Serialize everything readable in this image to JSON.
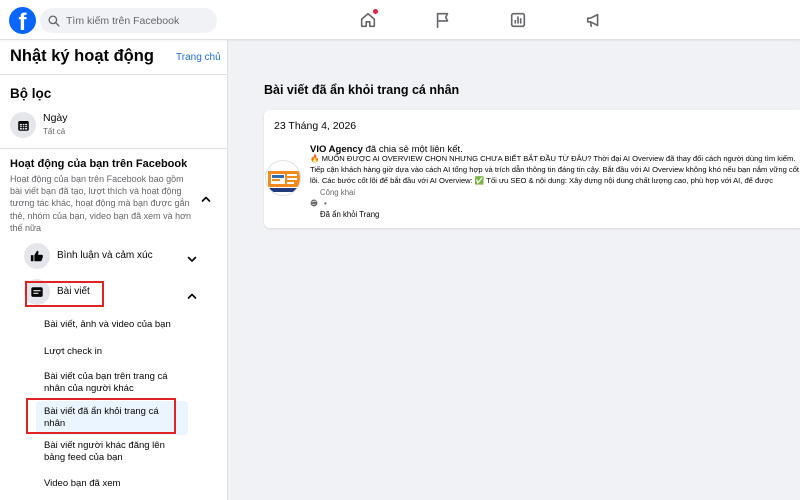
{
  "topbar": {
    "logo": "f",
    "search_placeholder": "Tìm kiếm trên Facebook",
    "icons": [
      "home-icon",
      "flag-icon",
      "chart-icon",
      "megaphone-icon"
    ]
  },
  "sidebar": {
    "title": "Nhật ký hoạt động",
    "home_link": "Trang chủ",
    "filter_heading": "Bộ lọc",
    "date_filter": {
      "label": "Ngày",
      "value": "Tất cả"
    },
    "activity": {
      "title": "Hoạt động của bạn trên Facebook",
      "description": "Hoạt động của bạn trên Facebook bao gồm bài viết bạn đã tạo, lượt thích và hoạt động tương tác khác, hoạt động mà bạn được gắn thẻ, nhóm của bạn, video bạn đã xem và hơn thế nữa"
    },
    "categories": [
      {
        "label": "Bình luận và cảm xúc"
      },
      {
        "label": "Bài viết"
      }
    ],
    "sub_items": [
      "Bài viết, ảnh và video của bạn",
      "Lượt check in",
      "Bài viết của bạn trên trang cá nhân của người khác",
      "Bài viết đã ẩn khỏi trang cá nhân",
      "Bài viết người khác đăng lên bảng feed của bạn",
      "Video bạn đã xem"
    ]
  },
  "main": {
    "heading": "Bài viết đã ẩn khỏi trang cá nhân",
    "card": {
      "date": "23 Tháng 4, 2026",
      "author": "VIO Agency",
      "action": " đã chia sẻ một liên kết.",
      "text": "🔥 MUỐN ĐƯỢC AI OVERVIEW CHỌN NHƯNG CHƯA BIẾT BẮT ĐẦU TỪ ĐÂU? Thời đại AI Overview đã thay đổi cách người dùng tìm kiếm. Tiếp cận khách hàng giờ dựa vào cách AI tổng hợp và trích dẫn thông tin đáng tin cậy. Bắt đầu với AI Overview không khó nếu bạn nắm vững cốt lõi. Các bước cốt lõi để bắt đầu với AI Overview: ✅ Tối ưu SEO & nội dung: Xây dựng nội dung chất lượng cao, phù hợp với AI, để được",
      "audience": "Công khai",
      "dot": "•",
      "status": "Đã ẩn khỏi Trang"
    }
  },
  "colors": {
    "brand": "#0866ff",
    "link": "#216fdb",
    "highlight": "#e02424",
    "active_bg": "#ebf5ff"
  }
}
